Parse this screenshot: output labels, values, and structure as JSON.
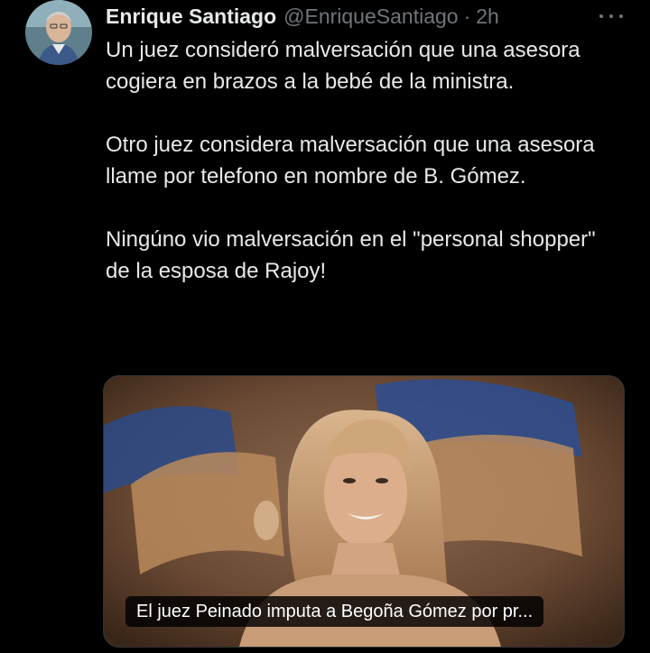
{
  "tweet": {
    "author_name": "Enrique Santiago",
    "author_handle": "@EnriqueSantiago",
    "separator": "·",
    "timestamp": "2h",
    "paragraphs": [
      "Un juez consideró malversación que una asesora cogiera en brazos a la bebé de la ministra.",
      "Otro juez considera malversación que una asesora llame por telefono en nombre de B. Gómez.",
      "Ningúno vio malversación en el \"personal shopper\" de la esposa de Rajoy!"
    ],
    "more_icon": "more-horizontal-icon",
    "media": {
      "caption": "El juez Peinado imputa a Begoña Gómez por pr..."
    }
  },
  "colors": {
    "background": "#000000",
    "text_primary": "#e7e9ea",
    "text_secondary": "#71767b",
    "border": "#2f3336"
  }
}
